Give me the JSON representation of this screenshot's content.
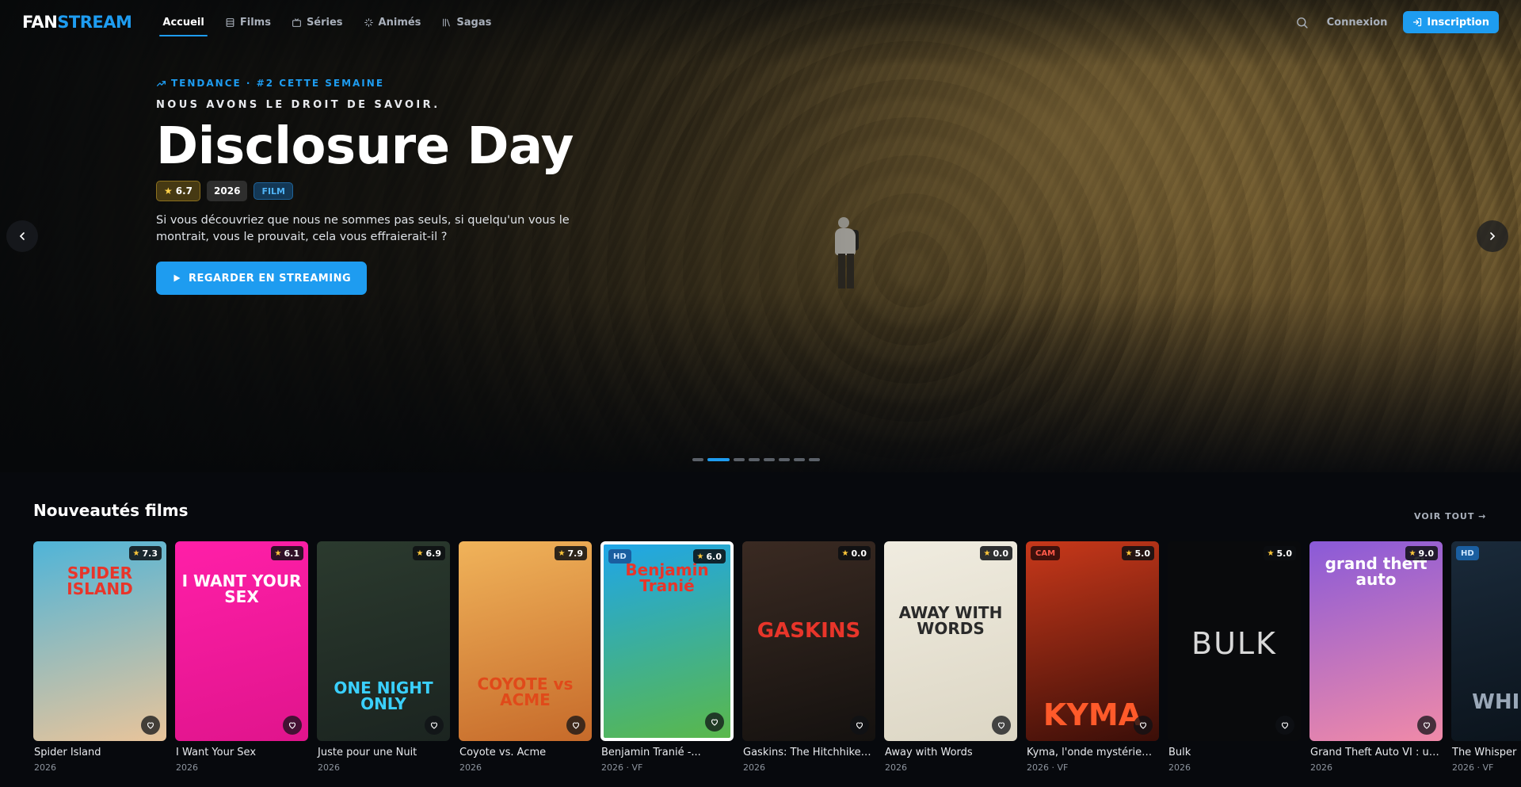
{
  "brand": {
    "part1": "FAN",
    "part2": "STREAM"
  },
  "nav": {
    "items": [
      {
        "label": "Accueil",
        "icon": "",
        "active": true
      },
      {
        "label": "Films",
        "icon": "film-icon",
        "active": false
      },
      {
        "label": "Séries",
        "icon": "tv-icon",
        "active": false
      },
      {
        "label": "Animés",
        "icon": "sparkle-icon",
        "active": false
      },
      {
        "label": "Sagas",
        "icon": "library-icon",
        "active": false
      }
    ],
    "login_label": "Connexion",
    "signup_label": "Inscription"
  },
  "hero": {
    "trend_label": "TENDANCE · #2 CETTE SEMAINE",
    "tagline": "NOUS AVONS LE DROIT DE SAVOIR.",
    "title": "Disclosure Day",
    "rating": "6.7",
    "year": "2026",
    "type_badge": "FILM",
    "synopsis": "Si vous découvriez que nous ne sommes pas seuls, si quelqu'un vous le montrait, vous le prouvait, cela vous effraierait-il ?",
    "cta_label": "REGARDER EN STREAMING",
    "slide_count": 8,
    "active_slide": 1
  },
  "section": {
    "title": "Nouveautés films",
    "see_all_label": "VOIR TOUT →",
    "movies": [
      {
        "title": "Spider Island",
        "meta": "2026",
        "rating": "7.3",
        "quality": "",
        "poster_text": "SPIDER ISLAND",
        "poster_color": "#e8352a",
        "bg1": "#4fb4d8",
        "bg2": "#e9c49a"
      },
      {
        "title": "I Want Your Sex",
        "meta": "2026",
        "rating": "6.1",
        "quality": "",
        "poster_text": "I WANT YOUR SEX",
        "poster_color": "#ffffff",
        "bg1": "#ff1fa8",
        "bg2": "#e0148c"
      },
      {
        "title": "Juste pour une Nuit",
        "meta": "2026",
        "rating": "6.9",
        "quality": "",
        "poster_text": "ONE NIGHT ONLY",
        "poster_color": "#3ad0ff",
        "bg1": "#2b3a2e",
        "bg2": "#1b2420"
      },
      {
        "title": "Coyote vs. Acme",
        "meta": "2026",
        "rating": "7.9",
        "quality": "",
        "poster_text": "COYOTE vs ACME",
        "poster_color": "#e04a1a",
        "bg1": "#f0b35a",
        "bg2": "#c66a2a"
      },
      {
        "title": "Benjamin Tranié -...",
        "meta": "2026 · VF",
        "rating": "6.0",
        "quality": "HD",
        "poster_text": "Benjamin Tranié",
        "poster_color": "#e8352a",
        "bg1": "#1fa6e8",
        "bg2": "#5ab84a"
      },
      {
        "title": "Gaskins: The Hitchhiker...",
        "meta": "2026",
        "rating": "0.0",
        "quality": "",
        "poster_text": "GASKINS",
        "poster_color": "#e8352a",
        "bg1": "#3a2a22",
        "bg2": "#14110f"
      },
      {
        "title": "Away with Words",
        "meta": "2026",
        "rating": "0.0",
        "quality": "",
        "poster_text": "AWAY WITH WORDS",
        "poster_color": "#2a2a2a",
        "bg1": "#f0ece0",
        "bg2": "#dcd6c4"
      },
      {
        "title": "Kyma, l'onde mystérieuse",
        "meta": "2026 · VF",
        "rating": "5.0",
        "quality": "CAM",
        "poster_text": "KYMA",
        "poster_color": "#ff5a2a",
        "bg1": "#c8381a",
        "bg2": "#3a0e08"
      },
      {
        "title": "Bulk",
        "meta": "2026",
        "rating": "5.0",
        "quality": "",
        "poster_text": "BULK",
        "poster_color": "#d8d8d8",
        "bg1": "#090a0c",
        "bg2": "#090a0c"
      },
      {
        "title": "Grand Theft Auto VI : un...",
        "meta": "2026",
        "rating": "9.0",
        "quality": "",
        "poster_text": "grand theft auto",
        "poster_color": "#ffffff",
        "bg1": "#8a5ad8",
        "bg2": "#f08aa8"
      },
      {
        "title": "The Whisper",
        "meta": "2026 · VF",
        "rating": "",
        "quality": "HD",
        "poster_text": "WHISPE",
        "poster_color": "#9aa8b8",
        "bg1": "#1a2a3a",
        "bg2": "#0a121a"
      }
    ]
  },
  "colors": {
    "accent": "#1e9cf0",
    "background": "#07090d",
    "star": "#ffc83a"
  }
}
